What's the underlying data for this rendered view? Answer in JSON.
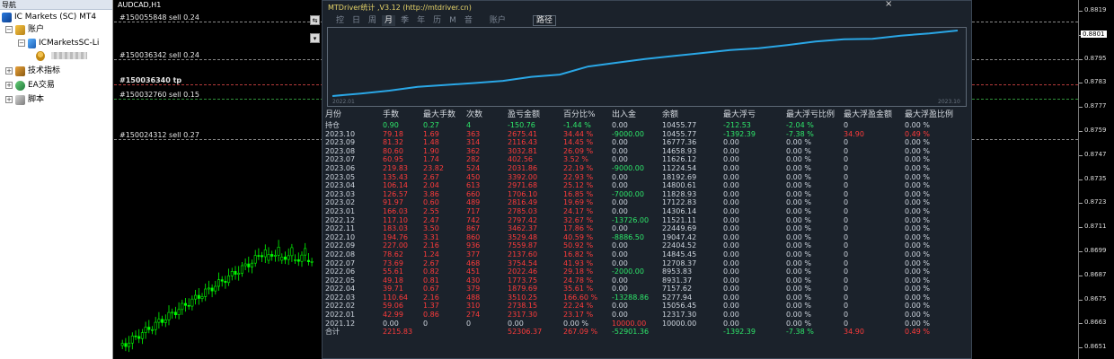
{
  "navigator": {
    "title": "导航",
    "items": [
      {
        "name": "terminal",
        "label": "IC Markets (SC) MT4"
      },
      {
        "name": "accounts",
        "label": "账户"
      },
      {
        "name": "server",
        "label": "ICMarketsSC-Li"
      },
      {
        "name": "user",
        "label": ""
      },
      {
        "name": "indicators",
        "label": "技术指标"
      },
      {
        "name": "ea",
        "label": "EA交易"
      },
      {
        "name": "scripts",
        "label": "脚本"
      }
    ],
    "icons": [
      "mt4-icon",
      "accounts-icon",
      "server-icon",
      "user-icon",
      "indicators-icon",
      "ea-icon",
      "scripts-icon"
    ]
  },
  "chart": {
    "symbol": "AUDCAD,H1",
    "orders": [
      {
        "label": "#150055848 sell 0.24"
      },
      {
        "label": "#150036342 sell 0.24"
      },
      {
        "label": "#150036340 tp"
      },
      {
        "label": "#150032760 sell 0.15"
      },
      {
        "label": "#150024312 sell 0.27"
      }
    ],
    "colors": {
      "candle": "#00ff00",
      "background": "#000000"
    }
  },
  "price_axis": {
    "labels": [
      "0.8819",
      "0.8801",
      "0.8795",
      "0.8783",
      "0.8777",
      "0.8759",
      "0.8747",
      "0.8735",
      "0.8723",
      "0.8711",
      "0.8699",
      "0.8687",
      "0.8675",
      "0.8663",
      "0.8651"
    ],
    "current": "0.8801"
  },
  "stats": {
    "title": "MTDriver统计 ,V3.12 (http://mtdriver.cn)",
    "close_icon": "×",
    "periods": [
      "控",
      "日",
      "周",
      "月",
      "季",
      "年",
      "历",
      "M",
      "音",
      "账户"
    ],
    "active_period": "月",
    "path_button": "路径",
    "equity_chart": {
      "start_label": "2022.01",
      "end_label": "2023.10"
    },
    "headers": [
      "月份",
      "手数",
      "最大手数",
      "次数",
      "盈亏金额",
      "百分比%",
      "出入金",
      "余额",
      "最大浮亏",
      "最大浮亏比例",
      "最大浮盈金额",
      "最大浮盈比例"
    ],
    "rows": [
      [
        "持仓",
        "0.90",
        "0.27",
        "4",
        "-150.76",
        "-1.44 %",
        "0.00",
        "10455.77",
        "-212.53",
        "-2.04 %",
        "0",
        "0.00 %"
      ],
      [
        "2023.10",
        "79.18",
        "1.69",
        "363",
        "2675.41",
        "34.44 %",
        "-9000.00",
        "10455.77",
        "-1392.39",
        "-7.38 %",
        "34.90",
        "0.49 %"
      ],
      [
        "2023.09",
        "81.32",
        "1.48",
        "314",
        "2116.43",
        "14.45 %",
        "0.00",
        "16777.36",
        "0.00",
        "0.00 %",
        "0",
        "0.00 %"
      ],
      [
        "2023.08",
        "80.60",
        "1.90",
        "362",
        "3032.81",
        "26.09 %",
        "0.00",
        "14658.93",
        "0.00",
        "0.00 %",
        "0",
        "0.00 %"
      ],
      [
        "2023.07",
        "60.95",
        "1.74",
        "282",
        "402.56",
        "3.52 %",
        "0.00",
        "11626.12",
        "0.00",
        "0.00 %",
        "0",
        "0.00 %"
      ],
      [
        "2023.06",
        "219.83",
        "23.82",
        "524",
        "2031.86",
        "22.19 %",
        "-9000.00",
        "11224.54",
        "0.00",
        "0.00 %",
        "0",
        "0.00 %"
      ],
      [
        "2023.05",
        "135.43",
        "2.67",
        "450",
        "3392.00",
        "22.93 %",
        "0.00",
        "18192.69",
        "0.00",
        "0.00 %",
        "0",
        "0.00 %"
      ],
      [
        "2023.04",
        "106.14",
        "2.04",
        "613",
        "2971.68",
        "25.12 %",
        "0.00",
        "14800.61",
        "0.00",
        "0.00 %",
        "0",
        "0.00 %"
      ],
      [
        "2023.03",
        "126.57",
        "3.86",
        "660",
        "1706.10",
        "16.85 %",
        "-7000.00",
        "11828.93",
        "0.00",
        "0.00 %",
        "0",
        "0.00 %"
      ],
      [
        "2023.02",
        "91.97",
        "0.60",
        "489",
        "2816.49",
        "19.69 %",
        "0.00",
        "17122.83",
        "0.00",
        "0.00 %",
        "0",
        "0.00 %"
      ],
      [
        "2023.01",
        "166.03",
        "2.55",
        "717",
        "2785.03",
        "24.17 %",
        "0.00",
        "14306.14",
        "0.00",
        "0.00 %",
        "0",
        "0.00 %"
      ],
      [
        "2022.12",
        "117.10",
        "2.47",
        "742",
        "2797.42",
        "32.67 %",
        "-13726.00",
        "11521.11",
        "0.00",
        "0.00 %",
        "0",
        "0.00 %"
      ],
      [
        "2022.11",
        "183.03",
        "3.50",
        "867",
        "3462.37",
        "17.86 %",
        "0.00",
        "22449.69",
        "0.00",
        "0.00 %",
        "0",
        "0.00 %"
      ],
      [
        "2022.10",
        "194.76",
        "3.31",
        "860",
        "3529.48",
        "40.59 %",
        "-8886.50",
        "19047.42",
        "0.00",
        "0.00 %",
        "0",
        "0.00 %"
      ],
      [
        "2022.09",
        "227.00",
        "2.16",
        "936",
        "7559.87",
        "50.92 %",
        "0.00",
        "22404.52",
        "0.00",
        "0.00 %",
        "0",
        "0.00 %"
      ],
      [
        "2022.08",
        "78.62",
        "1.24",
        "377",
        "2137.60",
        "16.82 %",
        "0.00",
        "14845.45",
        "0.00",
        "0.00 %",
        "0",
        "0.00 %"
      ],
      [
        "2022.07",
        "73.69",
        "2.67",
        "468",
        "3754.54",
        "41.93 %",
        "0.00",
        "12708.37",
        "0.00",
        "0.00 %",
        "0",
        "0.00 %"
      ],
      [
        "2022.06",
        "55.61",
        "0.82",
        "451",
        "2022.46",
        "29.18 %",
        "-2000.00",
        "8953.83",
        "0.00",
        "0.00 %",
        "0",
        "0.00 %"
      ],
      [
        "2022.05",
        "49.18",
        "0.81",
        "430",
        "1773.75",
        "24.78 %",
        "0.00",
        "8931.37",
        "0.00",
        "0.00 %",
        "0",
        "0.00 %"
      ],
      [
        "2022.04",
        "39.71",
        "0.67",
        "379",
        "1879.69",
        "35.61 %",
        "0.00",
        "7157.62",
        "0.00",
        "0.00 %",
        "0",
        "0.00 %"
      ],
      [
        "2022.03",
        "110.64",
        "2.16",
        "488",
        "3510.25",
        "166.60 %",
        "-13288.86",
        "5277.94",
        "0.00",
        "0.00 %",
        "0",
        "0.00 %"
      ],
      [
        "2022.02",
        "59.06",
        "1.37",
        "310",
        "2738.15",
        "22.24 %",
        "0.00",
        "15056.45",
        "0.00",
        "0.00 %",
        "0",
        "0.00 %"
      ],
      [
        "2022.01",
        "42.99",
        "0.86",
        "274",
        "2317.30",
        "23.17 %",
        "0.00",
        "12317.30",
        "0.00",
        "0.00 %",
        "0",
        "0.00 %"
      ],
      [
        "2021.12",
        "0.00",
        "0",
        "0",
        "0.00",
        "0.00 %",
        "10000.00",
        "10000.00",
        "0.00",
        "0.00 %",
        "0",
        "0.00 %"
      ],
      [
        "合计",
        "2215.83",
        "",
        "",
        "52306.37",
        "267.09 %",
        "-52901.36",
        "",
        "-1392.39",
        "-7.38 %",
        "34.90",
        "0.49 %"
      ]
    ],
    "colors": {
      "title": "#e8d56a",
      "header": "#d6dbe1",
      "default": "#cfd6df",
      "positive": "#ff3b3b",
      "negative": "#2ee66a",
      "equity_line": "#2aa7e6"
    }
  },
  "side_buttons": [
    "⇆",
    "▾"
  ]
}
